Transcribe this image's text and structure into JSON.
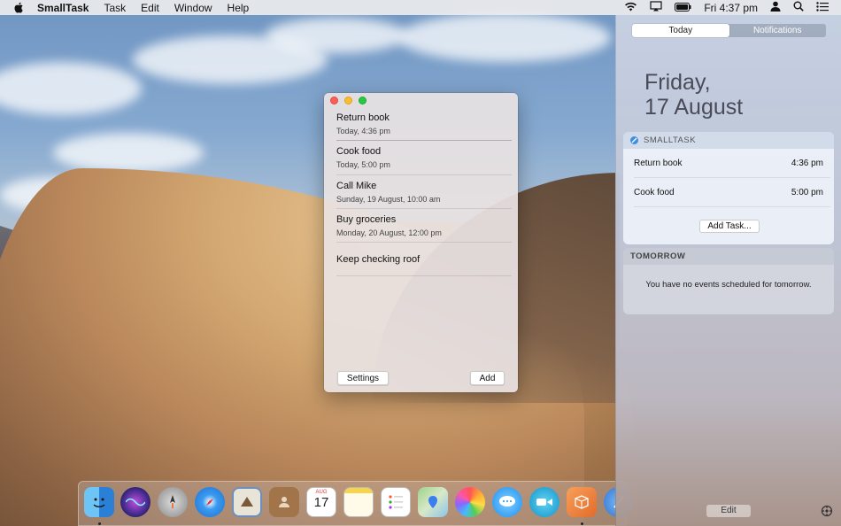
{
  "menubar": {
    "app_name": "SmallTask",
    "items": [
      "Task",
      "Edit",
      "Window",
      "Help"
    ],
    "clock": "Fri 4:37 pm",
    "status_icons": [
      "wifi-icon",
      "airplay-icon",
      "battery-icon",
      "user-icon",
      "spotlight-icon",
      "notification-center-icon"
    ]
  },
  "task_window": {
    "tasks": [
      {
        "title": "Return book",
        "time": "Today, 4:36 pm"
      },
      {
        "title": "Cook food",
        "time": "Today, 5:00 pm"
      },
      {
        "title": "Call Mike",
        "time": "Sunday, 19 August, 10:00 am"
      },
      {
        "title": "Buy groceries",
        "time": "Monday, 20 August, 12:00 pm"
      },
      {
        "title": "Keep checking roof",
        "time": ""
      }
    ],
    "settings_label": "Settings",
    "add_label": "Add"
  },
  "notification_center": {
    "tabs": [
      "Today",
      "Notifications"
    ],
    "active_tab": "Today",
    "date_line1": "Friday,",
    "date_line2": "17 August",
    "widget": {
      "title": "SMALLTASK",
      "rows": [
        {
          "label": "Return book",
          "time": "4:36 pm"
        },
        {
          "label": "Cook food",
          "time": "5:00 pm"
        }
      ],
      "add_task_label": "Add Task..."
    },
    "tomorrow": {
      "title": "TOMORROW",
      "message": "You have no events scheduled for tomorrow."
    },
    "edit_label": "Edit"
  },
  "dock": {
    "apps": [
      "finder-icon",
      "siri-icon",
      "launchpad-icon",
      "safari-icon",
      "mail-icon",
      "contacts-icon",
      "calendar-icon",
      "notes-icon",
      "reminders-icon",
      "maps-icon",
      "photos-icon",
      "messages-icon",
      "facetime-icon",
      "smalltask-icon",
      "xcode-icon"
    ],
    "calendar_month": "AUG",
    "calendar_day": "17"
  }
}
